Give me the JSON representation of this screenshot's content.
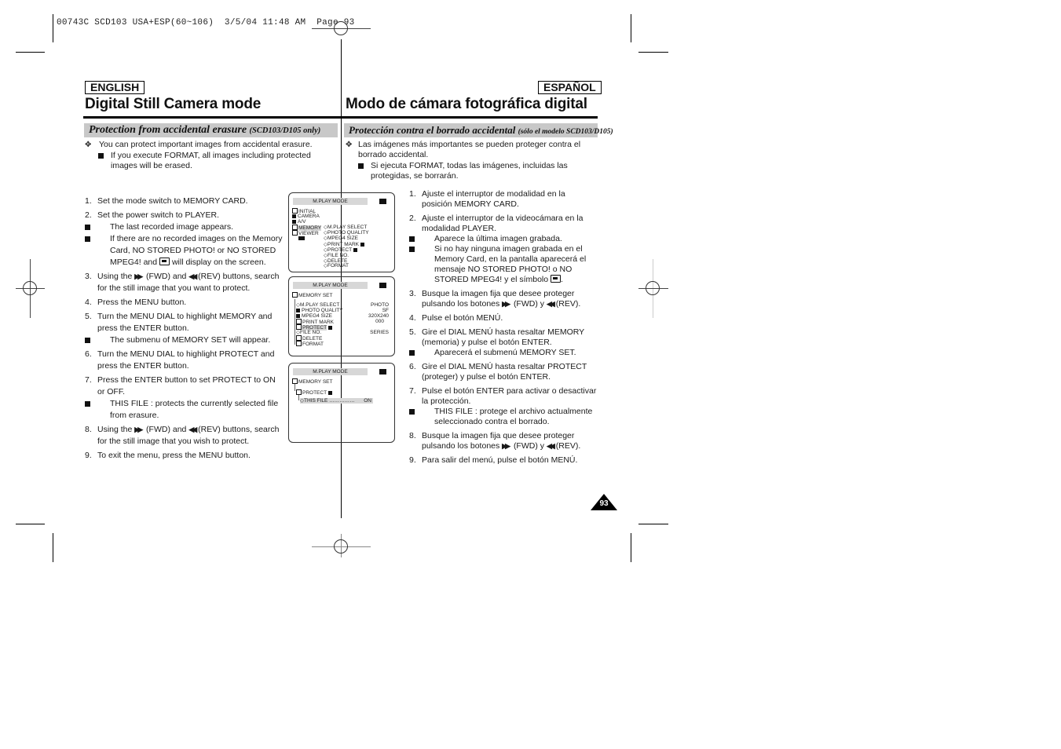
{
  "slug_line": "00743C SCD103 USA+ESP(60~106)  3/5/04 11:48 AM  Page 93",
  "english": {
    "lang_label": "ENGLISH",
    "title": "Digital Still Camera mode",
    "subhead": "Protection from accidental erasure",
    "subhead_note": "(SCD103/D105 only)",
    "intro": "You can protect important images from accidental erasure.",
    "intro_sub": "If you execute FORMAT, all images including protected images will be erased.",
    "steps": [
      {
        "num": "1.",
        "text": "Set the mode switch to MEMORY CARD."
      },
      {
        "num": "2.",
        "text": "Set the power switch to PLAYER.",
        "subs": [
          "The last recorded image appears.",
          "If there are no recorded images on the Memory Card, NO STORED PHOTO! or NO STORED MPEG4! and",
          "will display on the screen."
        ]
      },
      {
        "num": "3.",
        "pre": "Using the",
        "fwd": "(FWD) and",
        "rev": "(REV) buttons,",
        "text2": "search for the still image that you want to protect."
      },
      {
        "num": "4.",
        "text": "Press the MENU button."
      },
      {
        "num": "5.",
        "text": "Turn the MENU DIAL to highlight MEMORY and press the ENTER button.",
        "subs": [
          "The submenu of MEMORY SET will appear."
        ]
      },
      {
        "num": "6.",
        "text": "Turn the MENU DIAL to highlight PROTECT and press the ENTER button."
      },
      {
        "num": "7.",
        "text": "Press the ENTER button to set PROTECT to ON or OFF.",
        "subs": [
          "THIS FILE : protects the currently selected file from erasure."
        ]
      },
      {
        "num": "8.",
        "pre": "Using the",
        "fwd": "(FWD) and",
        "rev": "(REV) buttons,",
        "text2": "search for the still image that you wish to protect."
      },
      {
        "num": "9.",
        "text": "To exit the menu, press the MENU button."
      }
    ]
  },
  "espanol": {
    "lang_label": "ESPAÑOL",
    "title": "Modo de cámara fotográfica digital",
    "subhead": "Protección contra el borrado accidental",
    "subhead_note": "(sólo el modelo SCD103/D105)",
    "intro": "Las imágenes más importantes se pueden proteger contra el borrado accidental.",
    "intro_sub": "Si ejecuta FORMAT, todas las imágenes, incluidas las protegidas, se borrarán.",
    "steps": [
      {
        "num": "1.",
        "text": "Ajuste el interruptor de modalidad en la posición MEMORY CARD."
      },
      {
        "num": "2.",
        "text": "Ajuste el interruptor de la videocámara en la modalidad PLAYER.",
        "subs": [
          "Aparece la última imagen grabada.",
          "Si no hay ninguna imagen grabada en el Memory Card, en la pantalla aparecerá el mensaje NO STORED PHOTO! o NO STORED MPEG4! y el símbolo"
        ]
      },
      {
        "num": "3.",
        "text": "Busque la imagen fija que desee proteger",
        "pre": "pulsando los botones",
        "fwd": "(FWD) y",
        "rev": "(REV)."
      },
      {
        "num": "4.",
        "text": "Pulse el botón MENÚ."
      },
      {
        "num": "5.",
        "text": "Gire el DIAL MENÚ hasta resaltar MEMORY (memoria) y pulse el botón ENTER.",
        "subs": [
          "Aparecerá el submenú MEMORY SET."
        ]
      },
      {
        "num": "6.",
        "text": "Gire el DIAL MENÚ hasta resaltar PROTECT (proteger) y pulse el botón ENTER."
      },
      {
        "num": "7.",
        "text": "Pulse el botón ENTER para activar o desactivar la protección.",
        "subs": [
          "THIS FILE : protege el archivo actualmente seleccionado contra el borrado."
        ]
      },
      {
        "num": "8.",
        "text": "Busque la imagen fija que desee proteger",
        "pre": "pulsando los botones",
        "fwd": "(FWD) y",
        "rev": "(REV)."
      },
      {
        "num": "9.",
        "text": "Para salir del menú, pulse el botón MENÚ."
      }
    ]
  },
  "screens": [
    {
      "header": "M.PLAY MODE",
      "left_menu": [
        "INITIAL",
        "CAMERA",
        "A/V",
        "MEMORY",
        "VIEWER"
      ],
      "sub_menu": [
        "M.PLAY SELECT",
        "PHOTO QUALITY",
        "MPEG4 SIZE",
        "PRINT MARK",
        "PROTECT",
        "FILE NO.",
        "DELETE",
        "FORMAT"
      ]
    },
    {
      "header": "M.PLAY MODE",
      "title": "MEMORY SET",
      "rows": [
        {
          "label": "M.PLAY SELECT",
          "value": "PHOTO"
        },
        {
          "label": "PHOTO QUALITY",
          "value": "SF"
        },
        {
          "label": "MPEG4 SIZE",
          "value": "320X240"
        },
        {
          "label": "PRINT MARK",
          "value": "000"
        },
        {
          "label": "PROTECT",
          "value": ""
        },
        {
          "label": "FILE NO.",
          "value": "SERIES"
        },
        {
          "label": "DELETE",
          "value": ""
        },
        {
          "label": "FORMAT",
          "value": ""
        }
      ]
    },
    {
      "header": "M.PLAY MODE",
      "title": "MEMORY SET",
      "sub_title": "PROTECT",
      "row": {
        "label": "THIS FILE",
        "value": "ON"
      }
    }
  ],
  "page_number": "93"
}
